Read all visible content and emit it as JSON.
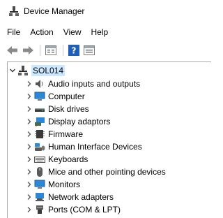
{
  "window": {
    "title": "Device Manager"
  },
  "menu": [
    "File",
    "Action",
    "View",
    "Help"
  ],
  "toolbar": {
    "buttons": [
      "back-arrow-icon",
      "forward-arrow-icon",
      "properties-icon",
      "help-icon",
      "view-icon"
    ]
  },
  "tree": {
    "root": {
      "label": "SOL014",
      "expanded": true
    },
    "items": [
      {
        "label": "Audio inputs and outputs",
        "icon": "speaker-icon"
      },
      {
        "label": "Computer",
        "icon": "monitor-icon"
      },
      {
        "label": "Disk drives",
        "icon": "disk-drive-icon"
      },
      {
        "label": "Display adaptors",
        "icon": "display-adapter-icon"
      },
      {
        "label": "Firmware",
        "icon": "firmware-icon"
      },
      {
        "label": "Human Interface Devices",
        "icon": "hid-icon"
      },
      {
        "label": "Keyboards",
        "icon": "keyboard-icon"
      },
      {
        "label": "Mice and other pointing devices",
        "icon": "mouse-icon"
      },
      {
        "label": "Monitors",
        "icon": "monitor-icon"
      },
      {
        "label": "Network adapters",
        "icon": "network-adapter-icon"
      },
      {
        "label": "Ports (COM & LPT)",
        "icon": "port-icon"
      }
    ]
  },
  "colors": {
    "selection": "#cce8ff",
    "accent": "#1e90ff"
  }
}
